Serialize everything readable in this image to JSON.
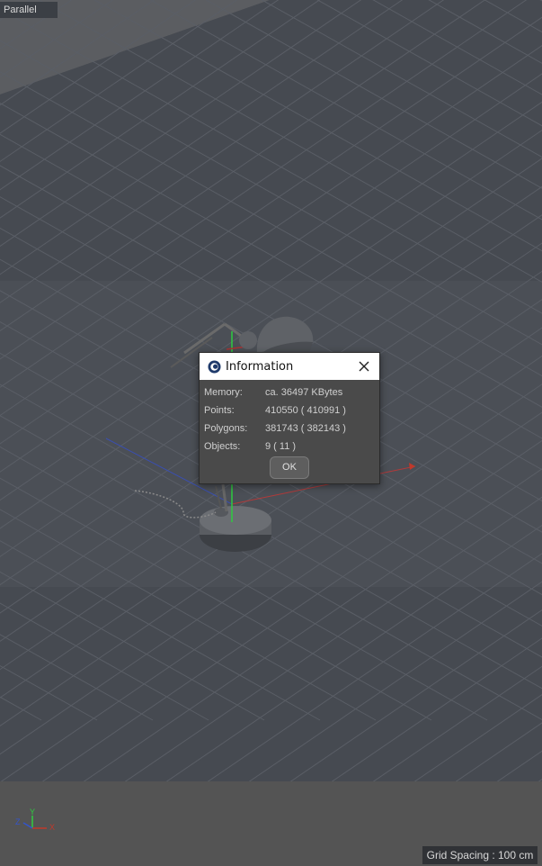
{
  "viewport": {
    "camera_label": "Parallel",
    "grid_spacing": "Grid Spacing : 100 cm",
    "axes": {
      "x": "X",
      "y": "Y",
      "z": "Z"
    }
  },
  "dialog": {
    "title": "Information",
    "icons": {
      "app": "cinema4d-logo-icon",
      "close": "close-icon"
    },
    "rows": [
      {
        "label": "Memory:",
        "value": "ca. 36497 KBytes"
      },
      {
        "label": "Points:",
        "value": "410550 ( 410991 )"
      },
      {
        "label": "Polygons:",
        "value": "381743 ( 382143 )"
      },
      {
        "label": "Objects:",
        "value": "9 ( 11 )"
      }
    ],
    "ok_label": "OK"
  },
  "colors": {
    "viewport_bg": "#4a4e55",
    "axis_x": "#c0392b",
    "axis_y": "#2ecc40",
    "axis_z": "#3355cc"
  }
}
